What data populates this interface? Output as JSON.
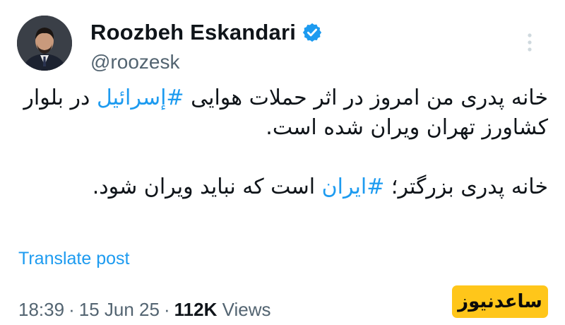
{
  "author": {
    "display_name": "Roozbeh Eskandari",
    "handle": "@roozesk",
    "verified_color": "#1d9bf0"
  },
  "tweet": {
    "paragraph1": {
      "before": "خانه پدری من امروز در اثر حملات هوایی ",
      "hashtag": "#إسرائيل",
      "after": " در بلوار کشاورز تهران ویران شده است."
    },
    "paragraph2": {
      "before": "خانه پدری بزرگتر؛ ",
      "hashtag": "#ایران",
      "after": " است که نباید ویران شود."
    }
  },
  "translate_label": "Translate post",
  "meta": {
    "time": "18:39",
    "separator": "·",
    "date": "15 Jun 25",
    "views_count": "112K",
    "views_label": "Views"
  },
  "watermark": {
    "text": "ساعدنیوز"
  },
  "colors": {
    "accent": "#1d9bf0",
    "muted": "#536471",
    "text": "#0f1419",
    "watermark_bg": "#ffc61a"
  }
}
